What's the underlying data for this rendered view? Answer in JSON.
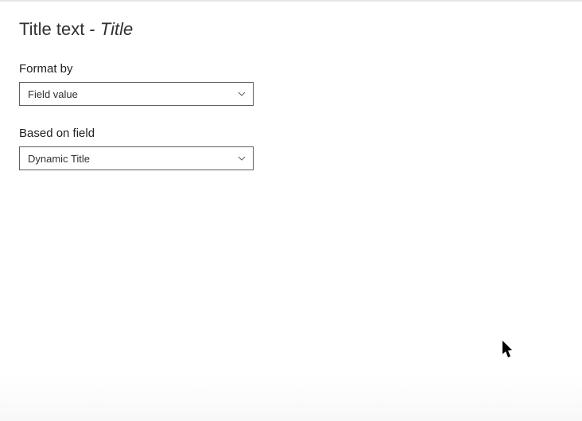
{
  "header": {
    "title_prefix": "Title text - ",
    "title_italic": "Title"
  },
  "fields": {
    "format_by": {
      "label": "Format by",
      "value": "Field value"
    },
    "based_on_field": {
      "label": "Based on field",
      "value": "Dynamic Title"
    }
  }
}
